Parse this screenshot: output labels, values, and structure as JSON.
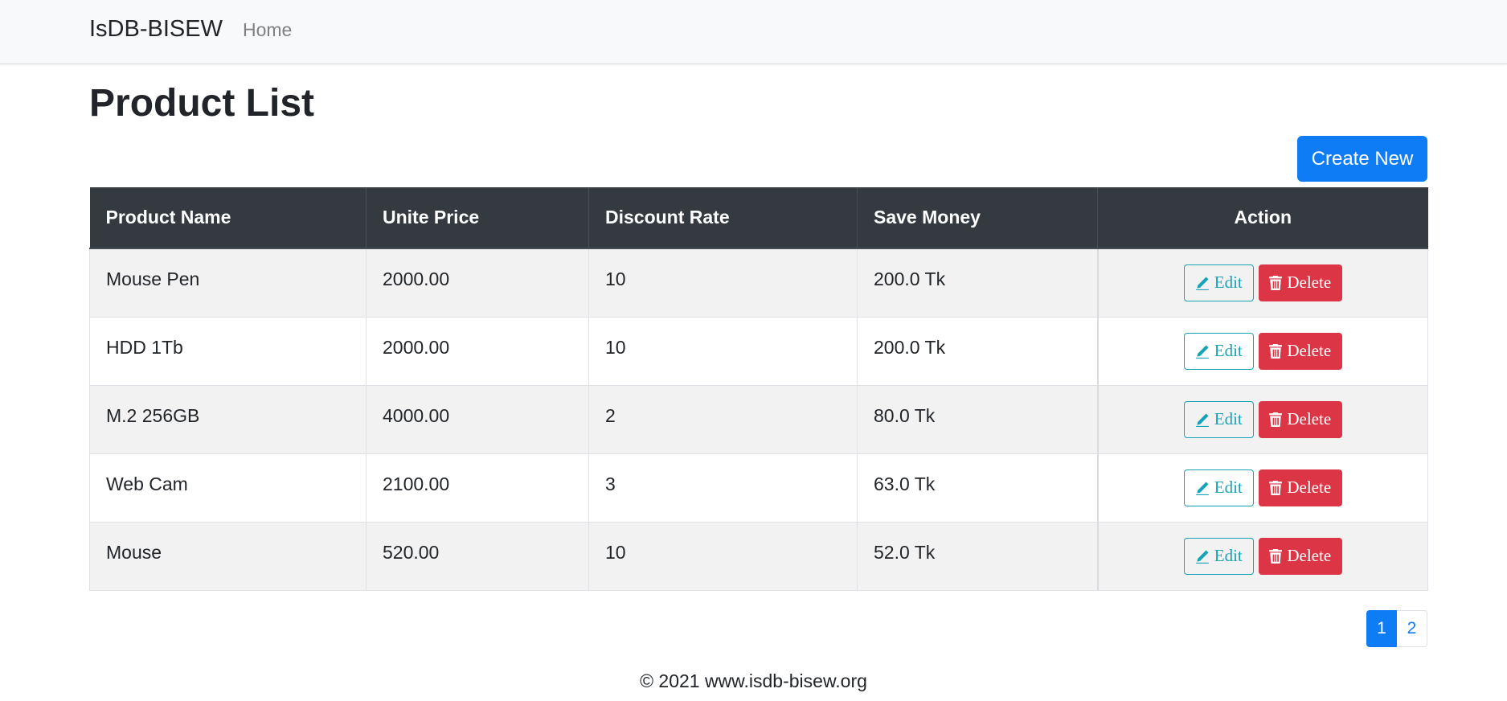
{
  "navbar": {
    "brand": "IsDB-BISEW",
    "home": "Home"
  },
  "page": {
    "title": "Product List",
    "create_label": "Create New"
  },
  "table": {
    "headers": [
      "Product Name",
      "Unite Price",
      "Discount Rate",
      "Save Money",
      "Action"
    ],
    "rows": [
      {
        "name": "Mouse Pen",
        "price": "2000.00",
        "discount": "10",
        "save": "200.0 Tk"
      },
      {
        "name": "HDD 1Tb",
        "price": "2000.00",
        "discount": "10",
        "save": "200.0 Tk"
      },
      {
        "name": "M.2 256GB",
        "price": "4000.00",
        "discount": "2",
        "save": "80.0 Tk"
      },
      {
        "name": "Web Cam",
        "price": "2100.00",
        "discount": "3",
        "save": "63.0 Tk"
      },
      {
        "name": "Mouse",
        "price": "520.00",
        "discount": "10",
        "save": "52.0 Tk"
      }
    ],
    "edit_label": "Edit",
    "delete_label": "Delete",
    "edit_icon": "pencil-icon",
    "delete_icon": "trash-icon"
  },
  "pagination": {
    "pages": [
      "1",
      "2"
    ],
    "active": "1"
  },
  "footer": {
    "text": "© 2021 www.isdb-bisew.org"
  },
  "colors": {
    "primary": "#0d7cf5",
    "danger": "#dc3545",
    "info": "#17a2b8",
    "table_header": "#343a40"
  }
}
